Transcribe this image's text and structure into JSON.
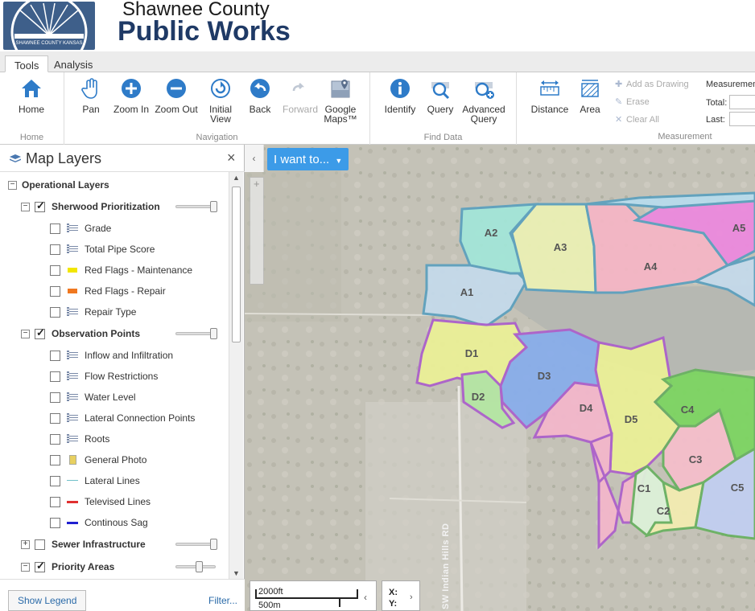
{
  "header": {
    "logo_text": "SHAWNEE COUNTY KANSAS",
    "title_line1": "Shawnee County",
    "title_line2": "Public Works"
  },
  "tabs": [
    {
      "label": "Tools",
      "active": true
    },
    {
      "label": "Analysis",
      "active": false
    }
  ],
  "ribbon": {
    "home_group": {
      "label": "Home",
      "tools": [
        {
          "label": "Home",
          "icon": "home-icon"
        }
      ]
    },
    "navigation_group": {
      "label": "Navigation",
      "tools": [
        {
          "label": "Pan",
          "icon": "hand-icon"
        },
        {
          "label": "Zoom In",
          "icon": "zoom-in-icon"
        },
        {
          "label": "Zoom Out",
          "icon": "zoom-out-icon"
        },
        {
          "label": "Initial View",
          "label_lines": [
            "Initial",
            "View"
          ],
          "icon": "refresh-icon"
        },
        {
          "label": "Back",
          "icon": "back-arrow-icon"
        },
        {
          "label": "Forward",
          "icon": "forward-arrow-icon",
          "disabled": true
        },
        {
          "label": "Google Maps™",
          "label_lines": [
            "Google",
            "Maps™"
          ],
          "icon": "google-maps-icon"
        }
      ]
    },
    "find_group": {
      "label": "Find Data",
      "tools": [
        {
          "label": "Identify",
          "icon": "info-icon"
        },
        {
          "label": "Query",
          "icon": "query-icon"
        },
        {
          "label": "Advanced Query",
          "label_lines": [
            "Advanced",
            "Query"
          ],
          "icon": "advanced-query-icon"
        }
      ]
    },
    "measurement_group": {
      "label": "Measurement",
      "tools": [
        {
          "label": "Distance",
          "icon": "ruler-icon"
        },
        {
          "label": "Area",
          "icon": "area-icon"
        }
      ],
      "mini_tools": [
        {
          "label": "Add as Drawing",
          "icon": "plus-icon"
        },
        {
          "label": "Erase",
          "icon": "eraser-icon"
        },
        {
          "label": "Clear All",
          "icon": "x-icon"
        }
      ],
      "results_title": "Measuremen",
      "total_label": "Total:",
      "last_label": "Last:"
    }
  },
  "panel": {
    "title": "Map Layers",
    "close": "×",
    "show_legend": "Show Legend",
    "filter": "Filter..."
  },
  "layers": [
    {
      "label": "Operational Layers",
      "level": 0,
      "bold": true,
      "expander": "−",
      "checkbox": false
    },
    {
      "label": "Sherwood Prioritization",
      "level": 1,
      "bold": true,
      "expander": "−",
      "checkbox": true,
      "checked": true,
      "slider": 1.0
    },
    {
      "label": "Grade",
      "level": 2,
      "checkbox": true,
      "checked": false,
      "symbol": "list"
    },
    {
      "label": "Total Pipe Score",
      "level": 2,
      "checkbox": true,
      "checked": false,
      "symbol": "list"
    },
    {
      "label": "Red Flags - Maintenance",
      "level": 2,
      "checkbox": true,
      "checked": false,
      "symbol": "fill-box",
      "color": "#f2e600"
    },
    {
      "label": "Red Flags - Repair",
      "level": 2,
      "checkbox": true,
      "checked": false,
      "symbol": "fill-box",
      "color": "#f07820"
    },
    {
      "label": "Repair Type",
      "level": 2,
      "checkbox": true,
      "checked": false,
      "symbol": "list"
    },
    {
      "label": "Observation Points",
      "level": 1,
      "bold": true,
      "expander": "−",
      "checkbox": true,
      "checked": true,
      "slider": 1.0
    },
    {
      "label": "Inflow and Infiltration",
      "level": 2,
      "checkbox": true,
      "checked": false,
      "symbol": "list"
    },
    {
      "label": "Flow Restrictions",
      "level": 2,
      "checkbox": true,
      "checked": false,
      "symbol": "list"
    },
    {
      "label": "Water Level",
      "level": 2,
      "checkbox": true,
      "checked": false,
      "symbol": "list"
    },
    {
      "label": "Lateral Connection Points",
      "level": 2,
      "checkbox": true,
      "checked": false,
      "symbol": "list"
    },
    {
      "label": "Roots",
      "level": 2,
      "checkbox": true,
      "checked": false,
      "symbol": "list"
    },
    {
      "label": "General Photo",
      "level": 2,
      "checkbox": true,
      "checked": false,
      "symbol": "photo",
      "color": "#e8d060"
    },
    {
      "label": "Lateral Lines",
      "level": 2,
      "checkbox": true,
      "checked": false,
      "symbol": "line",
      "color": "#6fc0c8"
    },
    {
      "label": "Televised Lines",
      "level": 2,
      "checkbox": true,
      "checked": false,
      "symbol": "line",
      "color": "#e03030"
    },
    {
      "label": "Continous Sag",
      "level": 2,
      "checkbox": true,
      "checked": false,
      "symbol": "line",
      "color": "#2020d0"
    },
    {
      "label": "Sewer Infrastructure",
      "level": 1,
      "bold": true,
      "expander": "+",
      "checkbox": true,
      "checked": false,
      "slider": 1.0
    },
    {
      "label": "Priority Areas",
      "level": 1,
      "bold": true,
      "expander": "−",
      "checkbox": true,
      "checked": true,
      "slider": 0.6
    }
  ],
  "map": {
    "i_want_to": "I want to...",
    "collapse": "‹",
    "scale_ft": "2000ft",
    "scale_m": "500m",
    "coord_x": "X:",
    "coord_y": "Y:",
    "road_label": "SW Indian Hills RD",
    "zones": [
      "A1",
      "A2",
      "A3",
      "A4",
      "A5",
      "D1",
      "D2",
      "D3",
      "D4",
      "D5",
      "C1",
      "C2",
      "C3",
      "C4",
      "C5"
    ]
  },
  "colors": {
    "accent": "#3c9be8",
    "title_dark": "#1f3a66",
    "zone_border_a": "#3a8cb0",
    "zone_border_d": "#9a3fc0",
    "zone_border_c": "#4aa040"
  }
}
